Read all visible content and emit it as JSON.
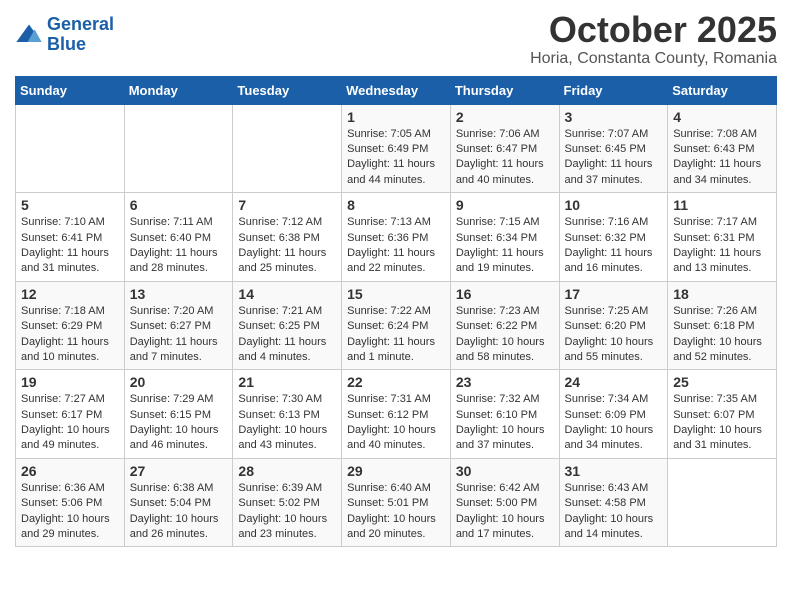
{
  "header": {
    "logo_line1": "General",
    "logo_line2": "Blue",
    "month": "October 2025",
    "location": "Horia, Constanta County, Romania"
  },
  "days_of_week": [
    "Sunday",
    "Monday",
    "Tuesday",
    "Wednesday",
    "Thursday",
    "Friday",
    "Saturday"
  ],
  "weeks": [
    [
      {
        "day": "",
        "content": ""
      },
      {
        "day": "",
        "content": ""
      },
      {
        "day": "",
        "content": ""
      },
      {
        "day": "1",
        "content": "Sunrise: 7:05 AM\nSunset: 6:49 PM\nDaylight: 11 hours and 44 minutes."
      },
      {
        "day": "2",
        "content": "Sunrise: 7:06 AM\nSunset: 6:47 PM\nDaylight: 11 hours and 40 minutes."
      },
      {
        "day": "3",
        "content": "Sunrise: 7:07 AM\nSunset: 6:45 PM\nDaylight: 11 hours and 37 minutes."
      },
      {
        "day": "4",
        "content": "Sunrise: 7:08 AM\nSunset: 6:43 PM\nDaylight: 11 hours and 34 minutes."
      }
    ],
    [
      {
        "day": "5",
        "content": "Sunrise: 7:10 AM\nSunset: 6:41 PM\nDaylight: 11 hours and 31 minutes."
      },
      {
        "day": "6",
        "content": "Sunrise: 7:11 AM\nSunset: 6:40 PM\nDaylight: 11 hours and 28 minutes."
      },
      {
        "day": "7",
        "content": "Sunrise: 7:12 AM\nSunset: 6:38 PM\nDaylight: 11 hours and 25 minutes."
      },
      {
        "day": "8",
        "content": "Sunrise: 7:13 AM\nSunset: 6:36 PM\nDaylight: 11 hours and 22 minutes."
      },
      {
        "day": "9",
        "content": "Sunrise: 7:15 AM\nSunset: 6:34 PM\nDaylight: 11 hours and 19 minutes."
      },
      {
        "day": "10",
        "content": "Sunrise: 7:16 AM\nSunset: 6:32 PM\nDaylight: 11 hours and 16 minutes."
      },
      {
        "day": "11",
        "content": "Sunrise: 7:17 AM\nSunset: 6:31 PM\nDaylight: 11 hours and 13 minutes."
      }
    ],
    [
      {
        "day": "12",
        "content": "Sunrise: 7:18 AM\nSunset: 6:29 PM\nDaylight: 11 hours and 10 minutes."
      },
      {
        "day": "13",
        "content": "Sunrise: 7:20 AM\nSunset: 6:27 PM\nDaylight: 11 hours and 7 minutes."
      },
      {
        "day": "14",
        "content": "Sunrise: 7:21 AM\nSunset: 6:25 PM\nDaylight: 11 hours and 4 minutes."
      },
      {
        "day": "15",
        "content": "Sunrise: 7:22 AM\nSunset: 6:24 PM\nDaylight: 11 hours and 1 minute."
      },
      {
        "day": "16",
        "content": "Sunrise: 7:23 AM\nSunset: 6:22 PM\nDaylight: 10 hours and 58 minutes."
      },
      {
        "day": "17",
        "content": "Sunrise: 7:25 AM\nSunset: 6:20 PM\nDaylight: 10 hours and 55 minutes."
      },
      {
        "day": "18",
        "content": "Sunrise: 7:26 AM\nSunset: 6:18 PM\nDaylight: 10 hours and 52 minutes."
      }
    ],
    [
      {
        "day": "19",
        "content": "Sunrise: 7:27 AM\nSunset: 6:17 PM\nDaylight: 10 hours and 49 minutes."
      },
      {
        "day": "20",
        "content": "Sunrise: 7:29 AM\nSunset: 6:15 PM\nDaylight: 10 hours and 46 minutes."
      },
      {
        "day": "21",
        "content": "Sunrise: 7:30 AM\nSunset: 6:13 PM\nDaylight: 10 hours and 43 minutes."
      },
      {
        "day": "22",
        "content": "Sunrise: 7:31 AM\nSunset: 6:12 PM\nDaylight: 10 hours and 40 minutes."
      },
      {
        "day": "23",
        "content": "Sunrise: 7:32 AM\nSunset: 6:10 PM\nDaylight: 10 hours and 37 minutes."
      },
      {
        "day": "24",
        "content": "Sunrise: 7:34 AM\nSunset: 6:09 PM\nDaylight: 10 hours and 34 minutes."
      },
      {
        "day": "25",
        "content": "Sunrise: 7:35 AM\nSunset: 6:07 PM\nDaylight: 10 hours and 31 minutes."
      }
    ],
    [
      {
        "day": "26",
        "content": "Sunrise: 6:36 AM\nSunset: 5:06 PM\nDaylight: 10 hours and 29 minutes."
      },
      {
        "day": "27",
        "content": "Sunrise: 6:38 AM\nSunset: 5:04 PM\nDaylight: 10 hours and 26 minutes."
      },
      {
        "day": "28",
        "content": "Sunrise: 6:39 AM\nSunset: 5:02 PM\nDaylight: 10 hours and 23 minutes."
      },
      {
        "day": "29",
        "content": "Sunrise: 6:40 AM\nSunset: 5:01 PM\nDaylight: 10 hours and 20 minutes."
      },
      {
        "day": "30",
        "content": "Sunrise: 6:42 AM\nSunset: 5:00 PM\nDaylight: 10 hours and 17 minutes."
      },
      {
        "day": "31",
        "content": "Sunrise: 6:43 AM\nSunset: 4:58 PM\nDaylight: 10 hours and 14 minutes."
      },
      {
        "day": "",
        "content": ""
      }
    ]
  ]
}
